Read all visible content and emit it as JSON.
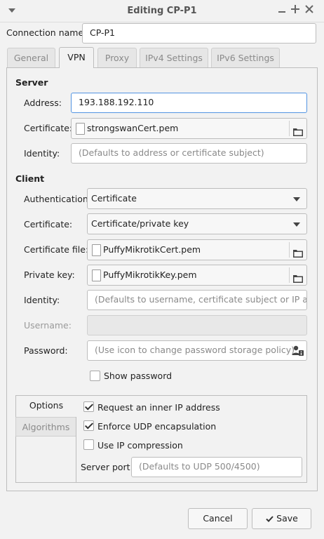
{
  "window": {
    "title": "Editing CP-P1",
    "menu_icon": "chevron-down-icon",
    "buttons": [
      "minimize-icon",
      "maximize-icon",
      "close-icon"
    ]
  },
  "connection": {
    "name_label": "Connection name",
    "name_value": "CP-P1"
  },
  "tabs": [
    {
      "label": "General",
      "active": false
    },
    {
      "label": "VPN",
      "active": true
    },
    {
      "label": "Proxy",
      "active": false
    },
    {
      "label": "IPv4 Settings",
      "active": false
    },
    {
      "label": "IPv6 Settings",
      "active": false
    }
  ],
  "server": {
    "section_title": "Server",
    "address_label": "Address:",
    "address_value": "193.188.192.110",
    "certificate_label": "Certificate:",
    "certificate_file": "strongswanCert.pem",
    "identity_label": "Identity:",
    "identity_placeholder": "(Defaults to address or certificate subject)"
  },
  "client": {
    "section_title": "Client",
    "auth_label": "Authentication:",
    "auth_value": "Certificate",
    "certificate_label": "Certificate:",
    "certificate_value": "Certificate/private key",
    "cert_file_label": "Certificate file:",
    "cert_file_value": "PuffyMikrotikCert.pem",
    "private_key_label": "Private key:",
    "private_key_value": "PuffyMikrotikKey.pem",
    "identity_label": "Identity:",
    "identity_placeholder": "(Defaults to username, certificate subject or IP add...",
    "username_label": "Username:",
    "username_value": "",
    "password_label": "Password:",
    "password_placeholder": "(Use icon to change password storage policy)",
    "show_password_label": "Show password",
    "show_password_checked": false
  },
  "options": {
    "side_tabs": [
      {
        "label": "Options",
        "active": true
      },
      {
        "label": "Algorithms",
        "active": false
      }
    ],
    "request_ip_label": "Request an inner IP address",
    "request_ip_checked": true,
    "enforce_udp_label": "Enforce UDP encapsulation",
    "enforce_udp_checked": true,
    "ip_compression_label": "Use IP compression",
    "ip_compression_checked": false,
    "server_port_label": "Server port:",
    "server_port_placeholder": "(Defaults to UDP 500/4500)"
  },
  "footer": {
    "cancel_label": "Cancel",
    "save_label": "Save",
    "save_icon": "checkmark-icon"
  }
}
